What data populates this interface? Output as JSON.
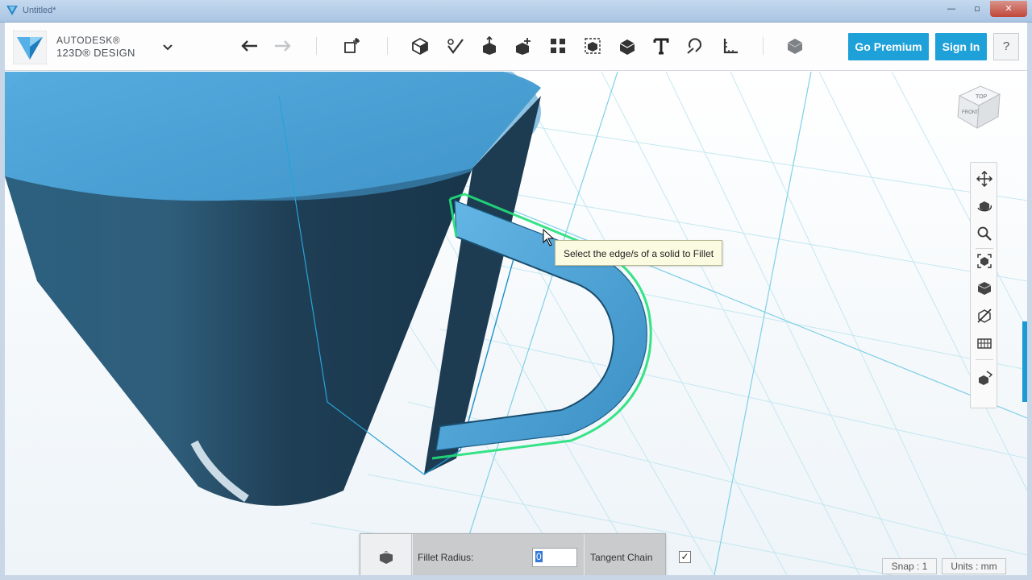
{
  "window": {
    "title": "Untitled*",
    "buttons": {
      "minimize": "—",
      "maximize": "▫",
      "close": "✕"
    }
  },
  "brand": {
    "line1": "AUTODESK®",
    "line2": "123D® DESIGN"
  },
  "toolbar": {
    "undo_icon": "undo-icon",
    "redo_icon": "redo-icon",
    "tools": [
      "primitives",
      "sketch",
      "construct",
      "modify",
      "pattern",
      "grouping",
      "combine",
      "text",
      "snap",
      "measure",
      "material"
    ],
    "go_premium": "Go Premium",
    "sign_in": "Sign In",
    "help": "?"
  },
  "viewport": {
    "tooltip": "Select the edge/s of a solid to Fillet",
    "viewcube": {
      "top": "TOP",
      "front": "FRONT"
    }
  },
  "nav_tools": [
    "pan",
    "orbit",
    "zoom",
    "fit",
    "views",
    "visibility",
    "materials-outlines",
    "grid-snap"
  ],
  "fillet_panel": {
    "radius_label": "Fillet Radius:",
    "radius_value": "0",
    "tangent_label": "Tangent Chain",
    "tangent_checked": "✓"
  },
  "status": {
    "snap": "Snap : 1",
    "units": "Units : mm"
  },
  "colors": {
    "accent": "#1da1d8",
    "model": "#4a9fd5",
    "selection": "#22e07a",
    "grid": "#bfe6f0"
  }
}
